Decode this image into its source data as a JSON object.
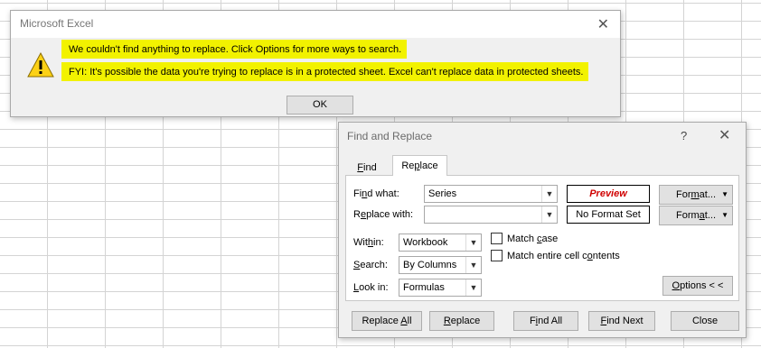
{
  "message_box": {
    "title": "Microsoft Excel",
    "line1": "We couldn't find anything to replace. Click Options for more ways to search.",
    "line2": "FYI: It's possible the data you're trying to replace is in a protected sheet. Excel can't replace data in protected sheets.",
    "ok_label": "OK",
    "close_glyph": "✕",
    "icon": "warning-icon",
    "highlight_color": "#f2f200"
  },
  "find_replace": {
    "title": "Find and Replace",
    "help_glyph": "?",
    "close_glyph": "✕",
    "tabs": [
      "Find",
      "Replace"
    ],
    "active_tab": "Replace",
    "find_what_label": "Find what:",
    "find_what_value": "Series",
    "replace_with_label": "Replace with:",
    "replace_with_value": "",
    "preview_label": "Preview",
    "no_format_label": "No Format Set",
    "format_label": "Format...",
    "within_label": "Within:",
    "within_value": "Workbook",
    "search_label": "Search:",
    "search_value": "By Columns",
    "lookin_label": "Look in:",
    "lookin_value": "Formulas",
    "match_case_label": "Match case",
    "match_case_checked": false,
    "match_entire_label": "Match entire cell contents",
    "match_entire_checked": false,
    "options_label": "Options < <",
    "buttons": {
      "replace_all": "Replace All",
      "replace": "Replace",
      "find_all": "Find All",
      "find_next": "Find Next",
      "close": "Close"
    },
    "preview_color": "#d00000"
  }
}
